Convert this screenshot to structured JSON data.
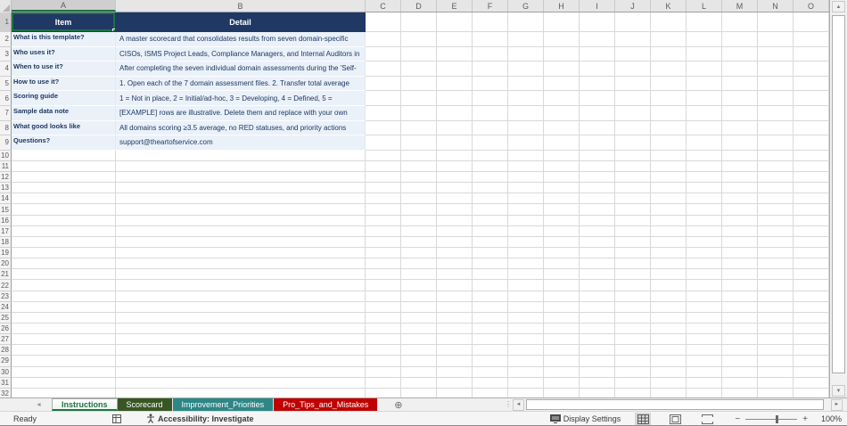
{
  "sheet": {
    "columns": [
      "A",
      "B",
      "C",
      "D",
      "E",
      "F",
      "G",
      "H",
      "I",
      "J",
      "K",
      "L",
      "M",
      "N",
      "O"
    ],
    "total_rows": 32,
    "selected_cell": "A1",
    "header_row": {
      "item": "Item",
      "detail": "Detail"
    },
    "rows": [
      {
        "item": "What is this template?",
        "detail": "A master scorecard that consolidates results from seven domain-specific"
      },
      {
        "item": "Who uses it?",
        "detail": "CISOs, ISMS Project Leads, Compliance Managers, and Internal Auditors in"
      },
      {
        "item": "When to use it?",
        "detail": "After completing the seven individual domain assessments during the 'Self-"
      },
      {
        "item": "How to use it?",
        "detail": "1. Open each of the 7 domain assessment files. 2. Transfer total average"
      },
      {
        "item": "Scoring guide",
        "detail": "1 = Not in place, 2 = Initial/ad-hoc, 3 = Developing, 4 = Defined, 5 ="
      },
      {
        "item": "Sample data note",
        "detail": "[EXAMPLE] rows are illustrative. Delete them and replace with your own"
      },
      {
        "item": "What good looks like",
        "detail": "All domains scoring ≥3.5 average, no RED statuses, and priority actions"
      },
      {
        "item": "Questions?",
        "detail": "support@theartofservice.com"
      }
    ]
  },
  "tabs": [
    {
      "label": "Instructions",
      "active": true,
      "color": "#217346"
    },
    {
      "label": "Scorecard",
      "active": false,
      "color": "#375623"
    },
    {
      "label": "Improvement_Priorities",
      "active": false,
      "color": "#2E8686"
    },
    {
      "label": "Pro_Tips_and_Mistakes",
      "active": false,
      "color": "#C00000"
    }
  ],
  "tabstrip": {
    "prev_arrow": "◄",
    "next_arrow": "►",
    "new_sheet": "⊕"
  },
  "scrollbars": {
    "up": "▲",
    "down": "▼",
    "left": "◄",
    "right": "►",
    "splitter": "⋮"
  },
  "status": {
    "ready": "Ready",
    "accessibility": "Accessibility: Investigate",
    "display_settings": "Display Settings",
    "zoom_minus": "−",
    "zoom_plus": "+",
    "zoom": "100%"
  },
  "colors": {
    "header_fill": "#1F3864",
    "row_fill": "#EAF1F9",
    "selection_green": "#1E7145",
    "tab_scorecard": "#375623",
    "tab_improvement": "#2E8686",
    "tab_protips": "#C00000"
  }
}
